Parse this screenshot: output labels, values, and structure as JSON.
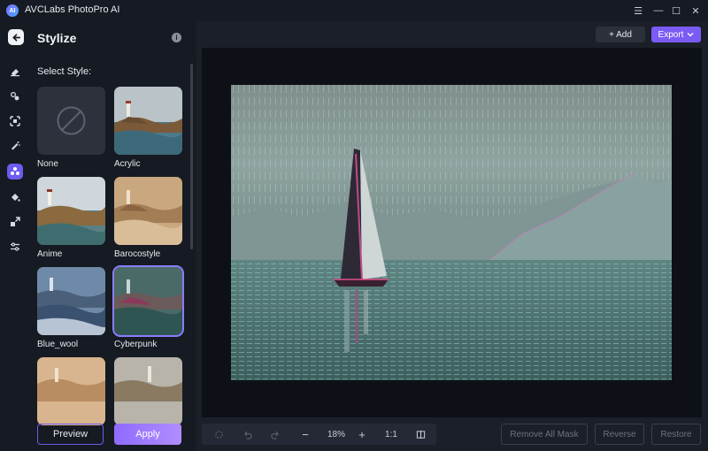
{
  "app": {
    "title": "AVCLabs PhotoPro AI",
    "logo_text": "AI"
  },
  "window_controls": [
    {
      "name": "menu-icon",
      "glyph": "☰"
    },
    {
      "name": "minimize-icon",
      "glyph": "—"
    },
    {
      "name": "maximize-icon",
      "glyph": "☐"
    },
    {
      "name": "close-icon",
      "glyph": "✕"
    }
  ],
  "panel": {
    "title": "Stylize",
    "info_glyph": "i",
    "select_label": "Select Style:",
    "styles": [
      {
        "label": "None",
        "selected": false
      },
      {
        "label": "Acrylic",
        "selected": false
      },
      {
        "label": "Anime",
        "selected": false
      },
      {
        "label": "Barocostyle",
        "selected": false
      },
      {
        "label": "Blue_wool",
        "selected": false
      },
      {
        "label": "Cyberpunk",
        "selected": true
      },
      {
        "label": "",
        "selected": false
      },
      {
        "label": "",
        "selected": false
      }
    ],
    "preview_label": "Preview",
    "apply_label": "Apply"
  },
  "rail_icons": [
    "back-arrow-icon",
    "eraser-icon",
    "face-swap-icon",
    "expand-icon",
    "enhance-icon",
    "stylize-icon",
    "paint-bucket-icon",
    "resize-icon",
    "adjust-icon"
  ],
  "toolbar": {
    "add_label": "+ Add",
    "export_label": "Export",
    "zoom": "18%",
    "zoom_out": "−",
    "zoom_in": "+",
    "ratio": "1:1"
  },
  "actions": {
    "remove_all_mask": "Remove All Mask",
    "reverse": "Reverse",
    "restore": "Restore"
  },
  "colors": {
    "accent": "#7a5cf5",
    "background": "#161a22",
    "canvas": "#0d1016"
  }
}
